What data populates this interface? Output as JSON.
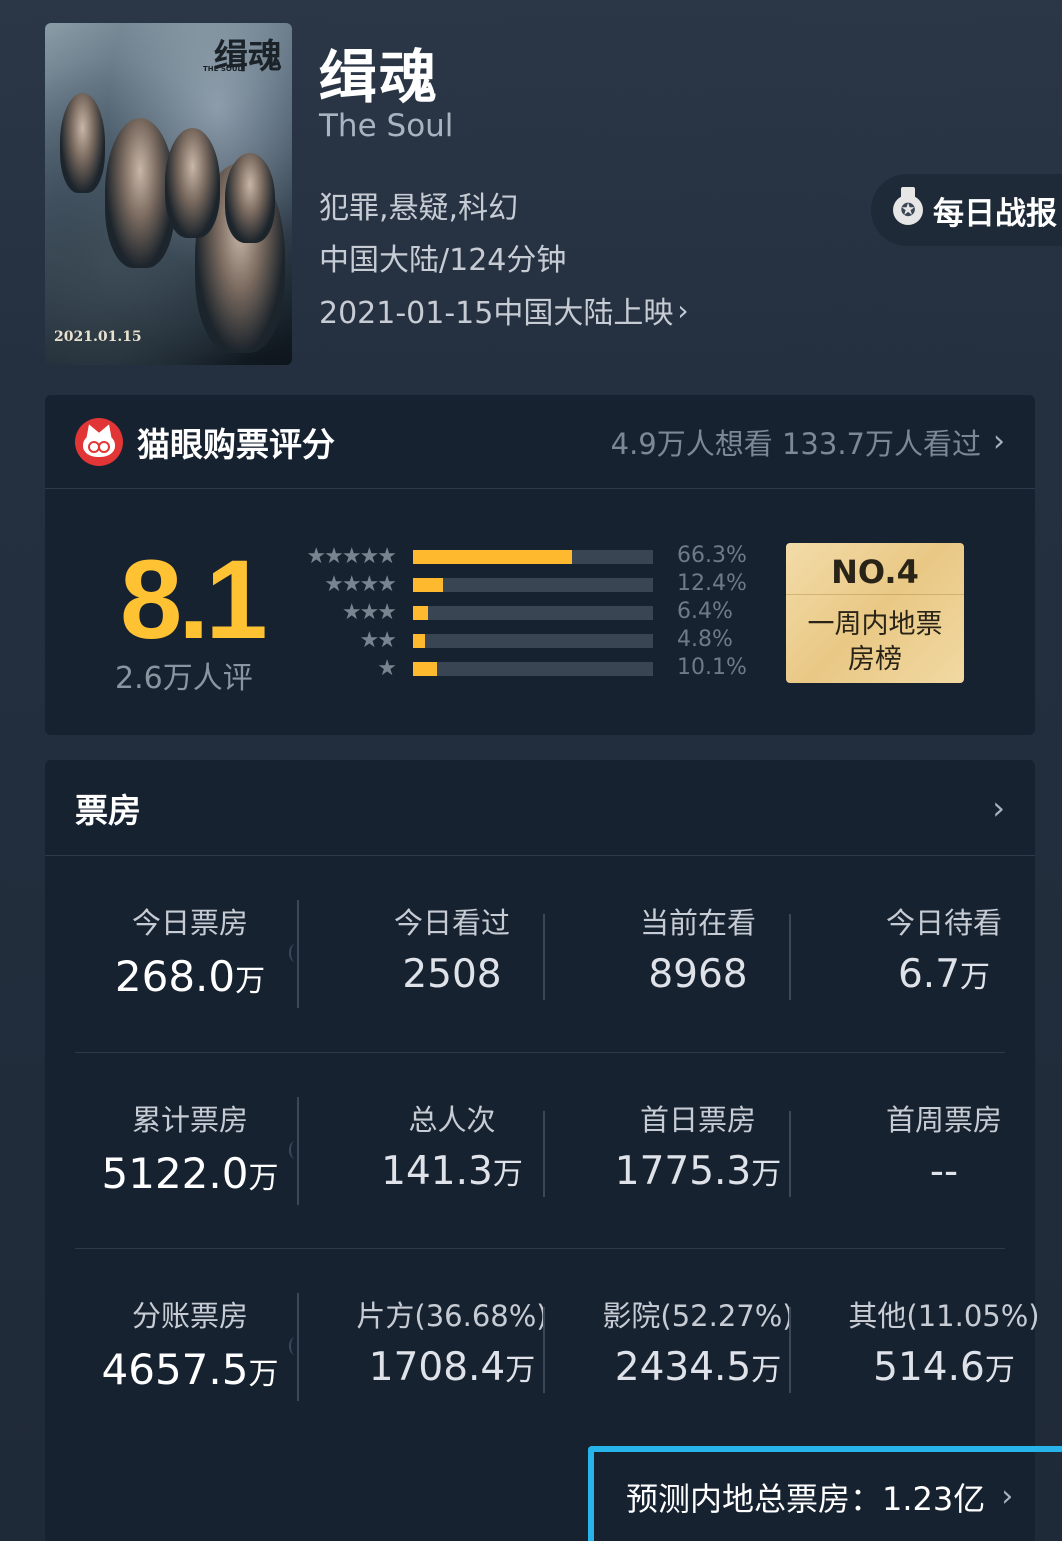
{
  "movie": {
    "poster_title": "缉魂",
    "poster_subtitle": "THE SOUL",
    "poster_date": "2021.01.15",
    "title": "缉魂",
    "english_title": "The Soul",
    "genres": "犯罪,悬疑,科幻",
    "region_duration": "中国大陆/124分钟",
    "release": "2021-01-15中国大陆上映",
    "chevron": "›"
  },
  "daily_report": {
    "label": "每日战报",
    "icon": "medal-icon"
  },
  "rating": {
    "section_title": "猫眼购票评分",
    "want_watched": "4.9万人想看 133.7万人看过",
    "score": "8.1",
    "count": "2.6万人评",
    "distribution": [
      {
        "stars": "★★★★★",
        "percent": 66.3,
        "label": "66.3%"
      },
      {
        "stars": "★★★★",
        "percent": 12.4,
        "label": "12.4%"
      },
      {
        "stars": "★★★",
        "percent": 6.4,
        "label": "6.4%"
      },
      {
        "stars": "★★",
        "percent": 4.8,
        "label": "4.8%"
      },
      {
        "stars": "★",
        "percent": 10.1,
        "label": "10.1%"
      }
    ],
    "rank": {
      "number": "NO.4",
      "label": "一周内地票房榜"
    },
    "accent": "#ffb92e"
  },
  "box_office": {
    "title": "票房",
    "rows": [
      [
        {
          "label": "今日票房",
          "value": "268.0",
          "unit": "万"
        },
        {
          "label": "今日看过",
          "value": "2508",
          "unit": ""
        },
        {
          "label": "当前在看",
          "value": "8968",
          "unit": ""
        },
        {
          "label": "今日待看",
          "value": "6.7",
          "unit": "万"
        }
      ],
      [
        {
          "label": "累计票房",
          "value": "5122.0",
          "unit": "万"
        },
        {
          "label": "总人次",
          "value": "141.3",
          "unit": "万"
        },
        {
          "label": "首日票房",
          "value": "1775.3",
          "unit": "万"
        },
        {
          "label": "首周票房",
          "value": "--",
          "unit": ""
        }
      ],
      [
        {
          "label": "分账票房",
          "value": "4657.5",
          "unit": "万"
        },
        {
          "label": "片方(36.68%)",
          "value": "1708.4",
          "unit": "万"
        },
        {
          "label": "影院(52.27%)",
          "value": "2434.5",
          "unit": "万"
        },
        {
          "label": "其他(11.05%)",
          "value": "514.6",
          "unit": "万"
        }
      ]
    ],
    "prediction": "预测内地总票房：1.23亿",
    "highlight_color": "#27b4ea"
  }
}
